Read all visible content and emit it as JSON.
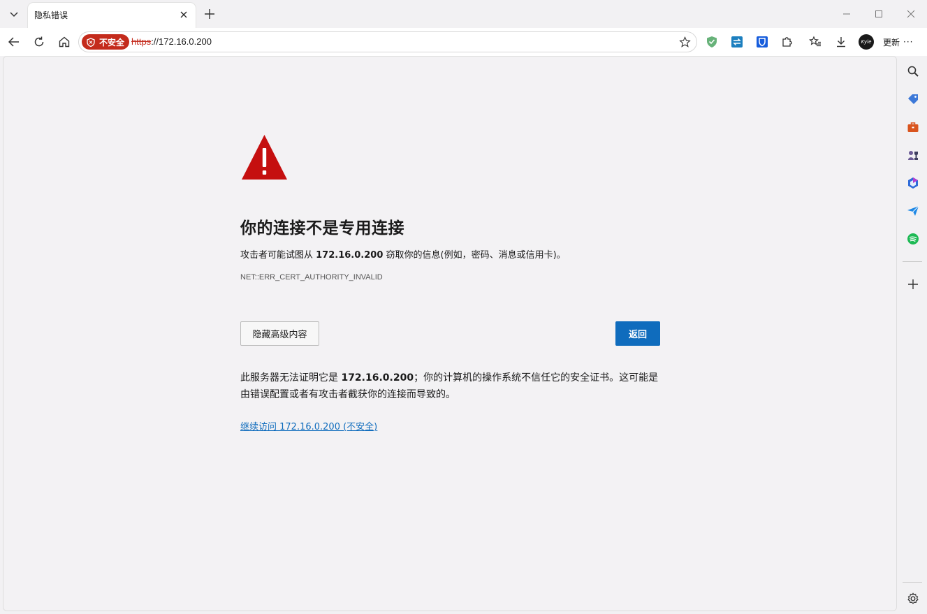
{
  "tab": {
    "title": "隐私错误"
  },
  "addressbar": {
    "security_label": "不安全",
    "url_scheme": "https",
    "url_rest": "://172.16.0.200"
  },
  "toolbar": {
    "update_label": "更新",
    "avatar_text": "Kyle"
  },
  "page": {
    "heading": "你的连接不是专用连接",
    "desc_prefix": "攻击者可能试图从 ",
    "desc_host": "172.16.0.200",
    "desc_suffix": " 窃取你的信息(例如，密码、消息或信用卡)。",
    "error_code": "NET::ERR_CERT_AUTHORITY_INVALID",
    "advanced_button": "隐藏高级内容",
    "back_button": "返回",
    "detail_prefix": "此服务器无法证明它是 ",
    "detail_host": "172.16.0.200",
    "detail_suffix": "；你的计算机的操作系统不信任它的安全证书。这可能是由错误配置或者有攻击者截获你的连接而导致的。",
    "proceed_link": "继续访问 172.16.0.200 (不安全)"
  },
  "colors": {
    "danger": "#c42b1c",
    "accent": "#0f6cbd"
  }
}
